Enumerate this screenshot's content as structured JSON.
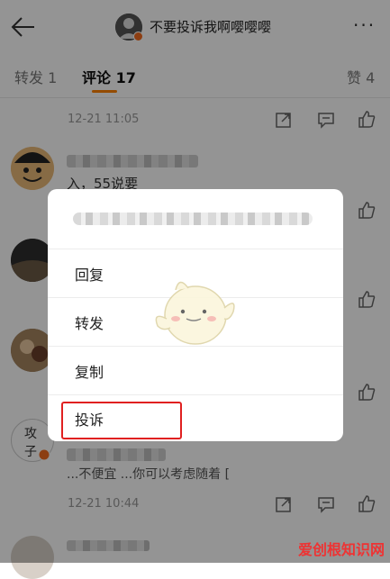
{
  "header": {
    "title": "不要投诉我啊嘤嘤嘤",
    "more": "···"
  },
  "tabs": {
    "repost": "转发 1",
    "comment": "评论 17",
    "likes": "赞 4"
  },
  "comments": [
    {
      "time": "12-21 11:05"
    },
    {
      "text_visible": "入，55说要"
    },
    {
      "text_visible": "...不便宜 ...你可以考虑随着 ["
    },
    {
      "time": "12-21 10:44"
    }
  ],
  "popup": {
    "items": [
      "回复",
      "转发",
      "复制",
      "投诉"
    ]
  },
  "watermark": "爱创根知识网",
  "colors": {
    "accent": "#ff8200",
    "highlight": "#e02020"
  }
}
